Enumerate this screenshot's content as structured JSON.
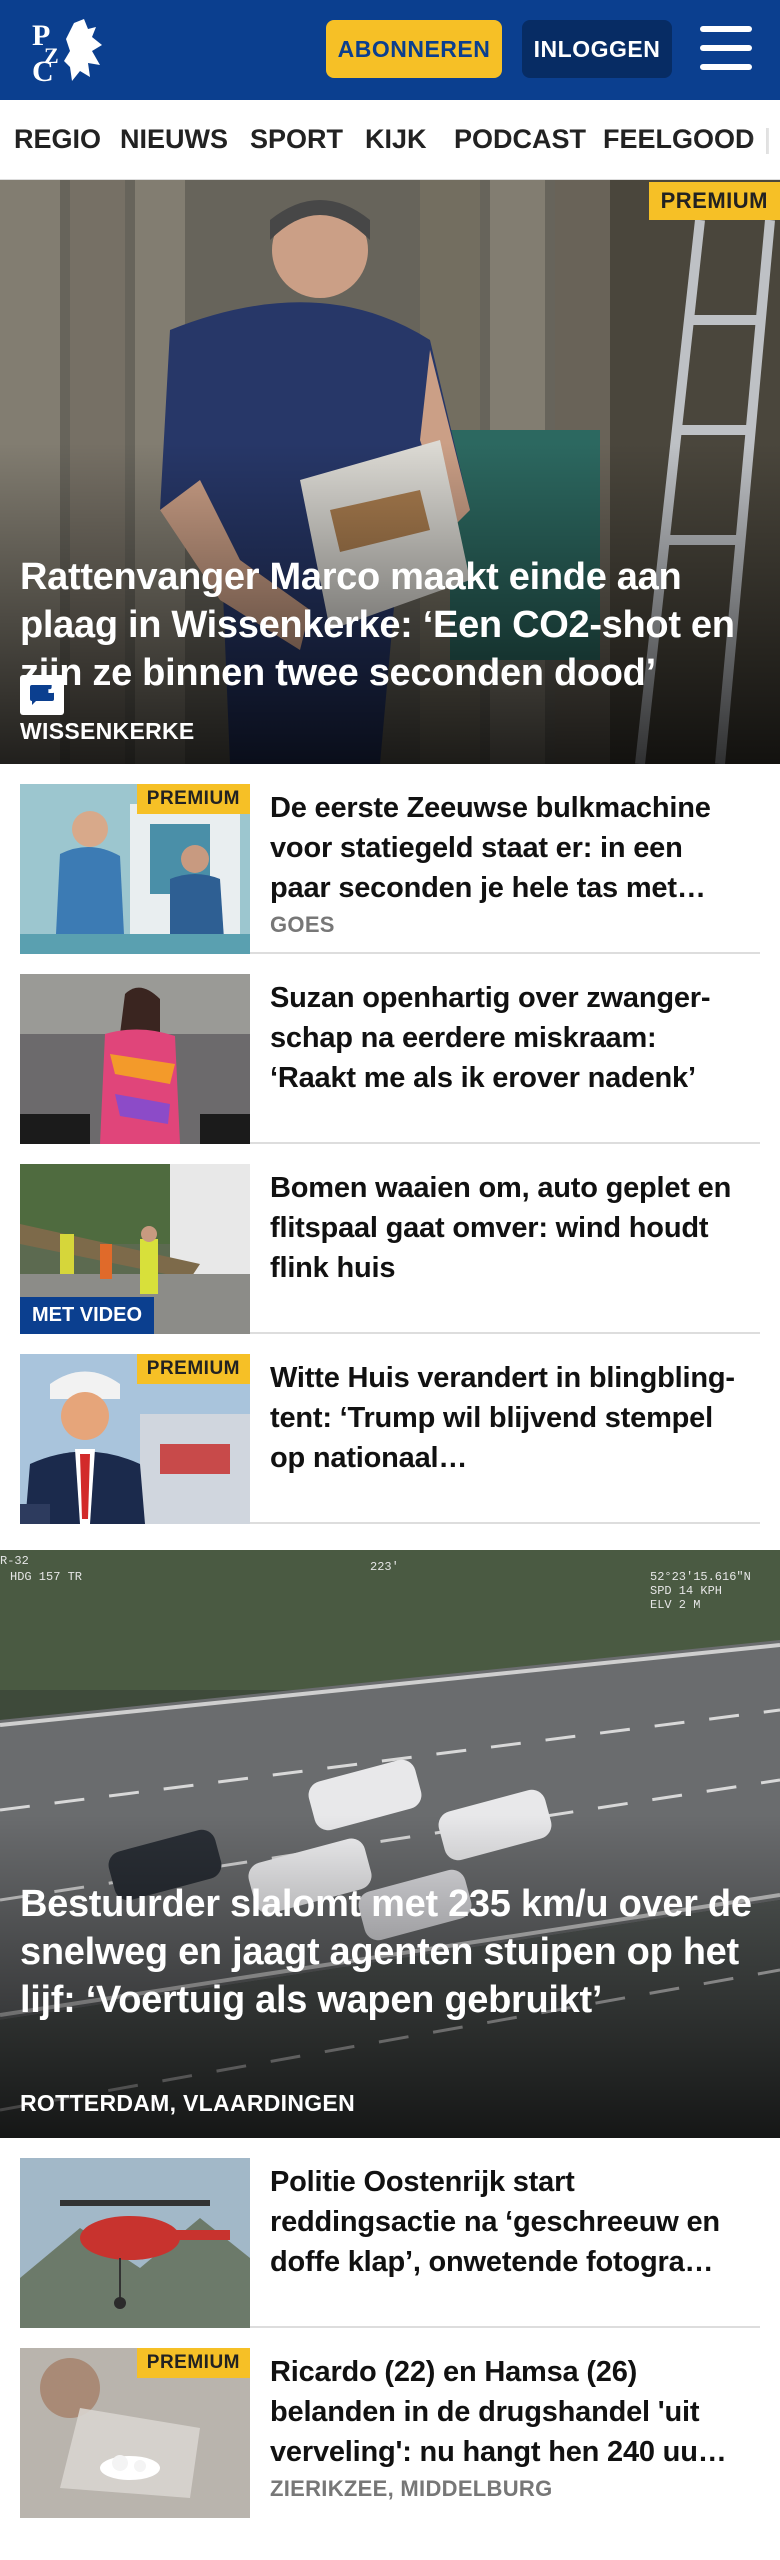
{
  "header": {
    "logo_text": "PZC",
    "subscribe_label": "ABONNEREN",
    "login_label": "INLOGGEN",
    "colors": {
      "brand": "#0b3f8f",
      "accent": "#f6c026"
    }
  },
  "nav": {
    "items": [
      "REGIO",
      "NIEUWS",
      "SPORT",
      "KIJK",
      "PODCAST",
      "FEELGOOD"
    ]
  },
  "hero1": {
    "badge": "PREMIUM",
    "title": "Rattenvanger Marco maakt einde aan plaag in Wissenkerke: ‘Een CO2-shot en zijn ze binnen twee seconden dood’",
    "place": "WISSENKERKE",
    "icon": "comment-icon"
  },
  "articles": [
    {
      "badge": "PREMIUM",
      "title": "De eerste Zeeuwse bulkmachine voor statiegeld staat er: in een paar seconden je hele tas met…",
      "place": "GOES"
    },
    {
      "title": "Suzan openhartig over zwanger­schap na eerdere miskraam: ‘Raakt me als ik erover nadenk’"
    },
    {
      "badge": "MET VIDEO",
      "title": "Bomen waaien om, auto geplet en flitspaal gaat omver: wind houdt flink huis"
    },
    {
      "badge": "PREMIUM",
      "title": "Witte Huis verandert in blingbling-tent: ‘Trump wil blijvend stempel op nationaal…"
    }
  ],
  "hero2": {
    "title": "Bestuurder slalomt met 235 km/u over de snelweg en jaagt agenten stuipen op het lijf: ‘Voertuig als wapen gebruikt’",
    "place": "ROTTERDAM, VLAARDINGEN"
  },
  "articles2": [
    {
      "title": "Politie Oostenrijk start reddingsactie na ‘geschreeuw en doffe klap’, onwetende fotogra…"
    },
    {
      "badge": "PREMIUM",
      "title": "Ricardo (22) en Hamsa (26) belanden in de drugshandel 'uit verveling': nu hangt hen 240 uu…",
      "place": "ZIERIKZEE, MIDDELBURG"
    }
  ]
}
